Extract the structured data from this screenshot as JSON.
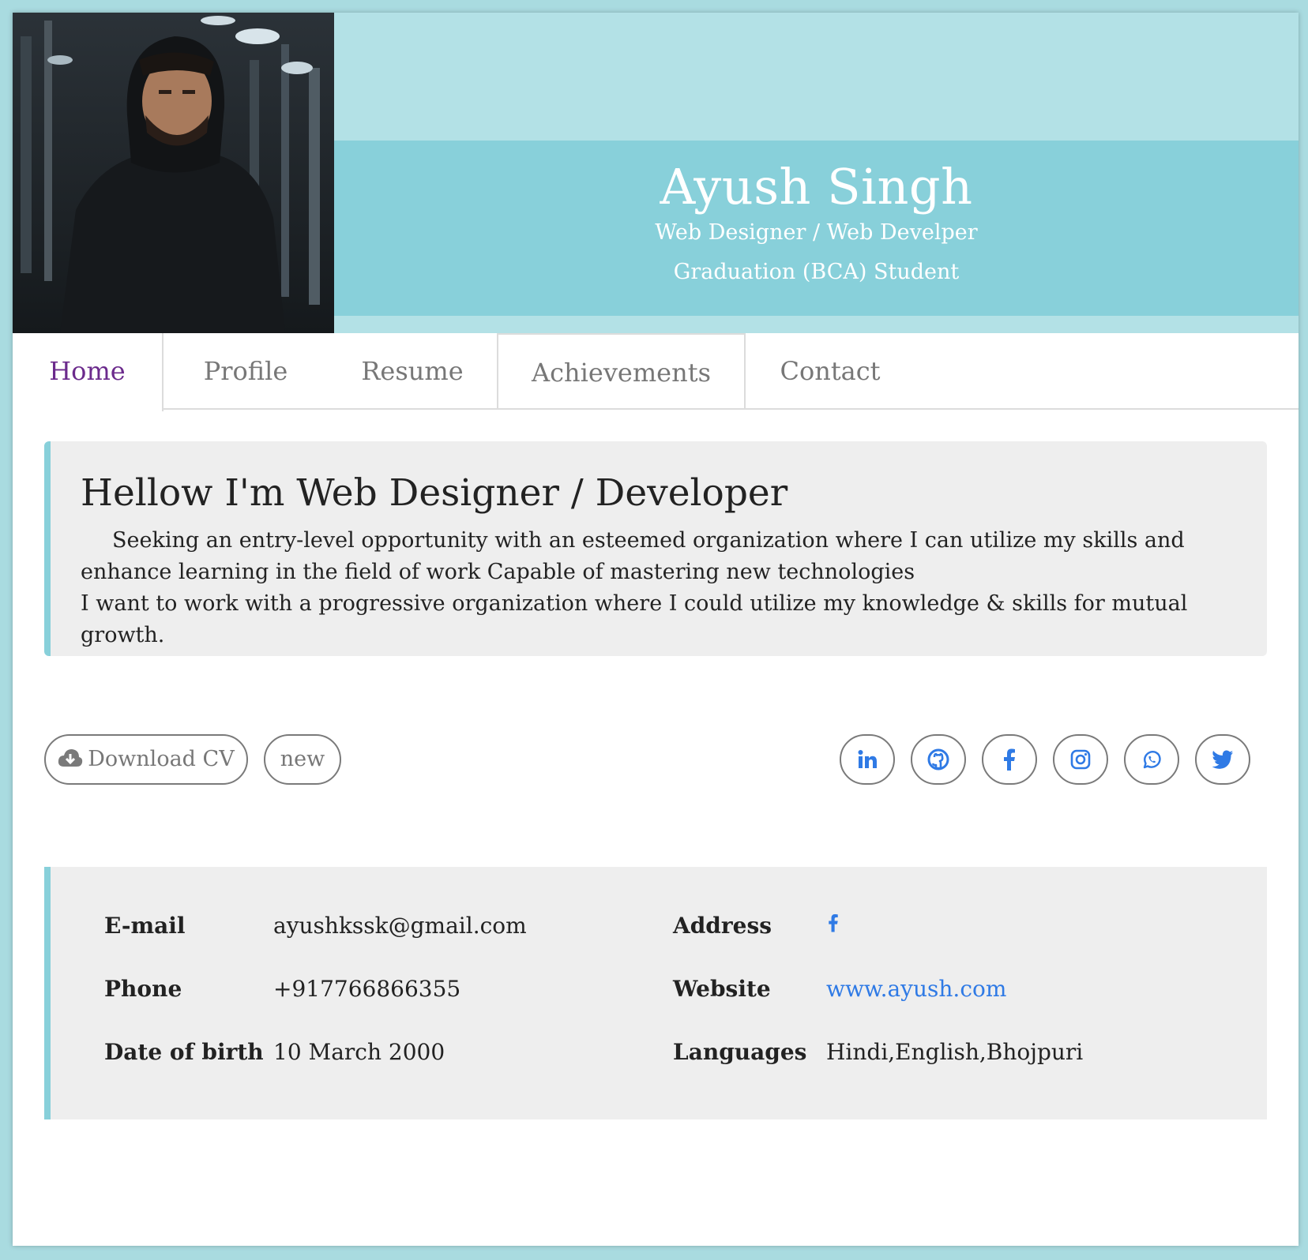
{
  "header": {
    "name": "Ayush Singh",
    "subtitle": "Web Designer / Web Develper",
    "subtitle2": "Graduation (BCA) Student",
    "band_color": "#88d0da"
  },
  "tabs": [
    {
      "label": "Home",
      "active": true
    },
    {
      "label": "Profile",
      "active": false
    },
    {
      "label": "Resume",
      "active": false
    },
    {
      "label": "Achievements",
      "active": false
    },
    {
      "label": "Contact",
      "active": false
    }
  ],
  "intro": {
    "heading": "Hellow I'm Web Designer / Developer",
    "line1": "Seeking an entry-level opportunity with an esteemed organization where I can utilize my skills and enhance learning in the field of work Capable of mastering new technologies",
    "line2": "I want to work with a progressive organization where I could utilize my knowledge & skills for mutual growth."
  },
  "actions": {
    "download_label": "Download CV",
    "download_icon": "cloud-download-icon",
    "new_label": "new"
  },
  "social": [
    "linkedin-icon",
    "github-icon",
    "facebook-icon",
    "instagram-icon",
    "whatsapp-icon",
    "twitter-icon"
  ],
  "info": {
    "email_label": "E-mail",
    "email": "ayushkssk@gmail.com",
    "phone_label": "Phone",
    "phone": "+917766866355",
    "dob_label": "Date of birth",
    "dob": "10 March 2000",
    "address_label": "Address",
    "address_icon": "facebook-icon",
    "website_label": "Website",
    "website": "www.ayush.com",
    "languages_label": "Languages",
    "languages": "Hindi,English,Bhojpuri"
  },
  "colors": {
    "accent": "#88d0da",
    "link": "#2f7ae5",
    "active_tab": "#6b2a8c"
  }
}
